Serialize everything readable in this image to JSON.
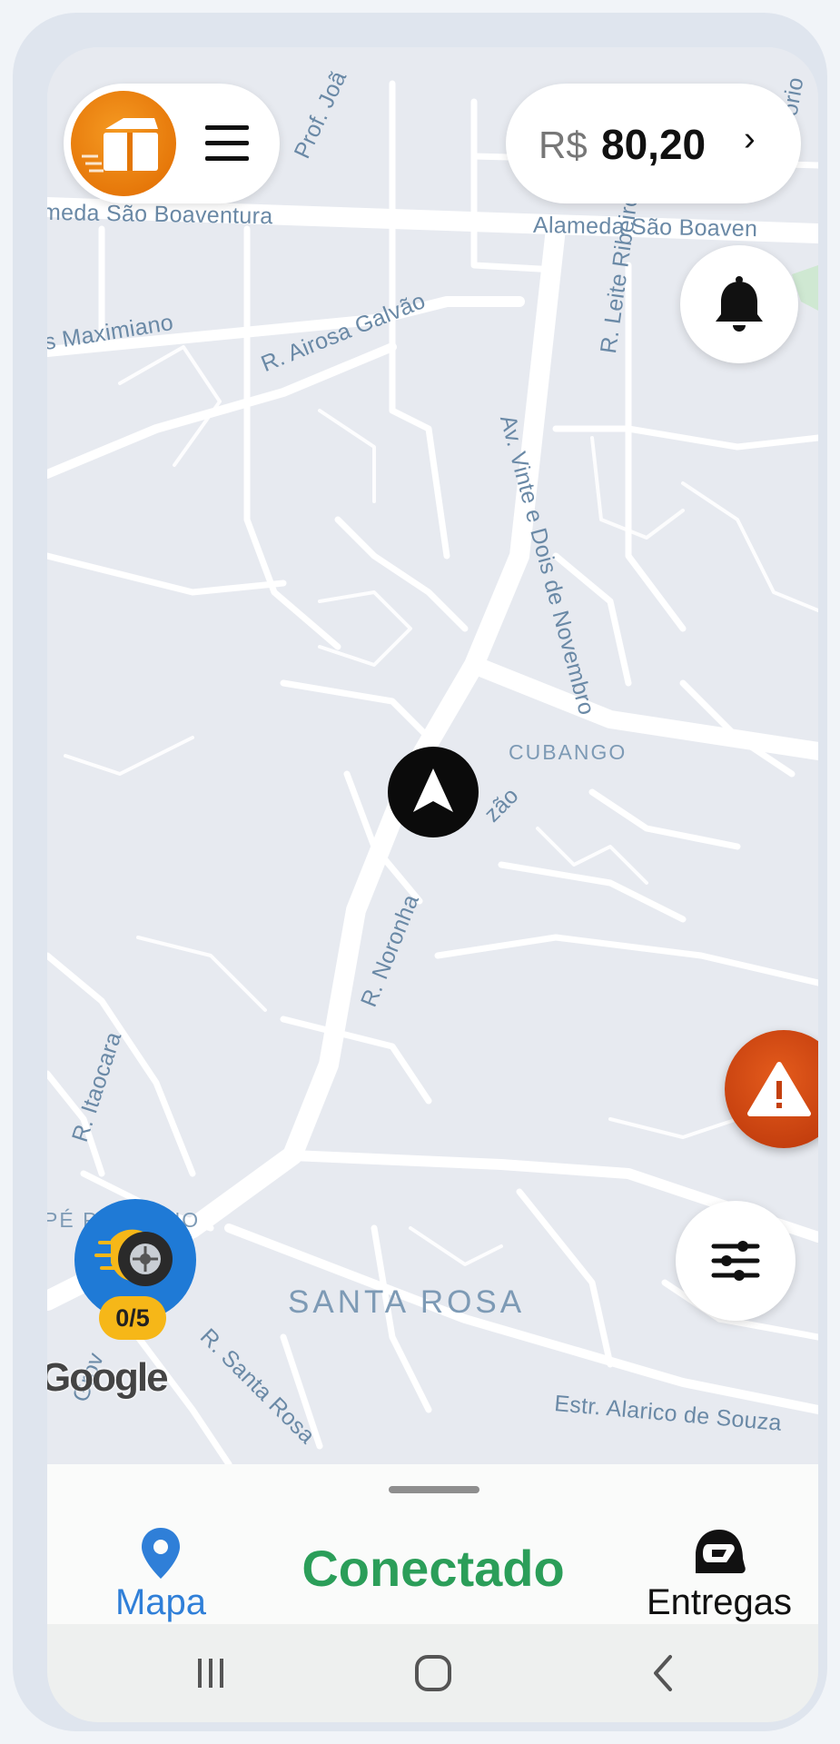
{
  "header": {
    "balance_currency": "R$",
    "balance_value": "80,20",
    "balance_chevron": "›"
  },
  "map": {
    "streets": [
      "Alameda São Boaventura",
      "Alameda São Boaven",
      "meda São Boaventura",
      "s Maximiano",
      "R. Airosa Galvão",
      "R. Leite Ribeiro",
      "Av. Vinte e Dois de Novembro",
      "R. Noronha",
      "zão",
      "R. Itaocara",
      "R. Santa Rosa",
      "Estr. Alarico de Souza",
      "Prof. Joã",
      "Grov",
      "ório"
    ],
    "areas": [
      "CUBANGO",
      "SANTA ROSA",
      "PÉ PEQUENO"
    ],
    "attribution": "Google"
  },
  "deliveries_counter": "0/5",
  "bottom_nav": {
    "map_label": "Mapa",
    "status": "Conectado",
    "deliveries_label": "Entregas"
  },
  "icons": {
    "logo": "delivery-box-icon",
    "menu": "hamburger-menu-icon",
    "bell": "bell-icon",
    "alert": "warning-icon",
    "filter": "sliders-icon",
    "marker": "navigation-arrow-icon",
    "map_tab": "map-pin-icon",
    "deliveries_tab": "helmet-icon"
  },
  "colors": {
    "accent_orange": "#e67a06",
    "status_green": "#2b9e59",
    "tab_blue": "#2f7fd8",
    "alert_red": "#c7400f"
  }
}
